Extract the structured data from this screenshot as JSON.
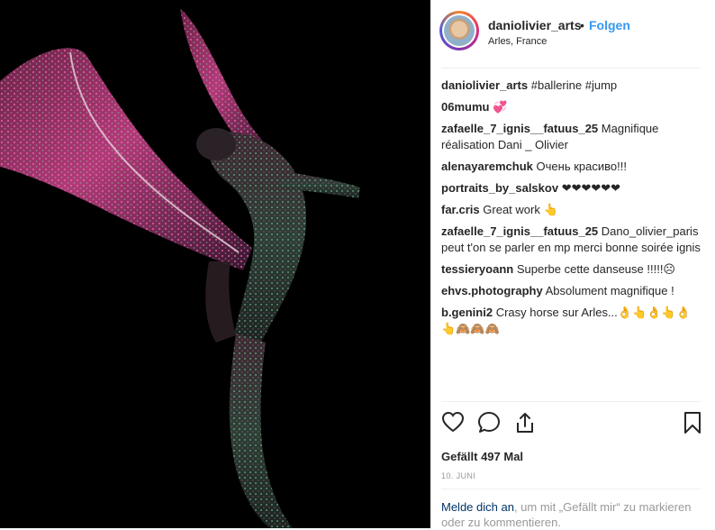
{
  "post": {
    "image_alt": "",
    "author": "daniolivier_arts",
    "separator": "•",
    "follow_label": "Folgen",
    "location": "Arles, France"
  },
  "comments": [
    {
      "user": "daniolivier_arts",
      "text": "#ballerine #jump"
    },
    {
      "user": "06mumu",
      "text": "💞"
    },
    {
      "user": "zafaelle_7_ignis__fatuus_25",
      "text": "Magnifique réalisation Dani _ Olivier"
    },
    {
      "user": "alenayaremchuk",
      "text": "Очень красиво!!!"
    },
    {
      "user": "portraits_by_salskov",
      "text": "❤❤❤❤❤❤"
    },
    {
      "user": "far.cris",
      "text": "Great work 👆"
    },
    {
      "user": "zafaelle_7_ignis__fatuus_25",
      "text": "Dano_olivier_paris peut t'on se parler en mp merci bonne soirée ignis"
    },
    {
      "user": "tessieryoann",
      "text": "Superbe cette danseuse !!!!!☹"
    },
    {
      "user": "ehvs.photography",
      "text": "Absolument magnifique !"
    },
    {
      "user": "b.genini2",
      "text": "Crasy horse sur Arles...👌👆👌👆👌👆🙈🙈🙈"
    }
  ],
  "actions": {
    "like_icon": "heart-icon",
    "comment_icon": "comment-icon",
    "share_icon": "share-icon",
    "save_icon": "bookmark-icon"
  },
  "likes_text": "Gefällt 497 Mal",
  "date_text": "10. JUNI",
  "login_prompt": {
    "link": "Melde dich an",
    "rest": ", um mit „Gefällt mir“ zu markieren oder zu kommentieren."
  },
  "colors": {
    "link_blue": "#3897f0",
    "hashtag_blue": "#003569",
    "muted": "#999999"
  }
}
